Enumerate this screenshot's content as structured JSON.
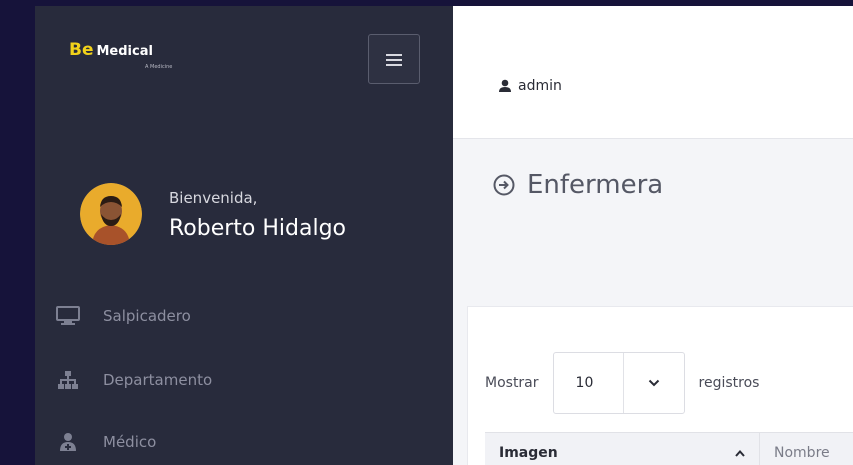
{
  "brand": {
    "be": "Be",
    "medical": "Medical",
    "subtitle": "A Medicine"
  },
  "sidebar": {
    "welcome": "Bienvenida,",
    "user_name": "Roberto Hidalgo",
    "items": [
      {
        "label": "Salpicadero",
        "icon": "monitor-icon"
      },
      {
        "label": "Departamento",
        "icon": "sitemap-icon"
      },
      {
        "label": "Médico",
        "icon": "doctor-icon"
      }
    ]
  },
  "topbar": {
    "user": "admin"
  },
  "page": {
    "title": "Enfermera"
  },
  "table": {
    "show_label": "Mostrar",
    "page_length": "10",
    "records_label": "registros",
    "columns": [
      "Imagen",
      "Nombre"
    ]
  },
  "colors": {
    "sidebar_bg": "#282b3c",
    "brand_yellow": "#f2d21a",
    "page_bg": "#16133a"
  }
}
